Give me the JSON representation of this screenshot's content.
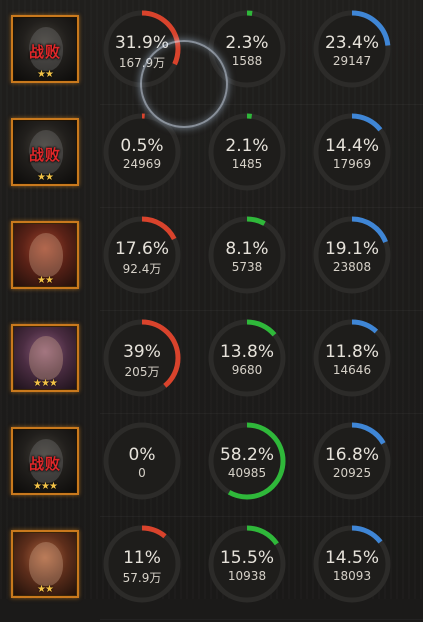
{
  "defeat_label": "战败",
  "colors": {
    "damage": "#d9432c",
    "heal": "#2fb83a",
    "taken": "#3f86d6",
    "track": "#2c2b29"
  },
  "rows": [
    {
      "defeated": true,
      "stars": "★★",
      "portrait": "grey",
      "damage": {
        "pct": "31.9%",
        "value": "167.9万",
        "fill": 0.319
      },
      "heal": {
        "pct": "2.3%",
        "value": "1588",
        "fill": 0.023
      },
      "taken": {
        "pct": "23.4%",
        "value": "29147",
        "fill": 0.234
      }
    },
    {
      "defeated": true,
      "stars": "★★",
      "portrait": "grey",
      "damage": {
        "pct": "0.5%",
        "value": "24969",
        "fill": 0.005
      },
      "heal": {
        "pct": "2.1%",
        "value": "1485",
        "fill": 0.021
      },
      "taken": {
        "pct": "14.4%",
        "value": "17969",
        "fill": 0.144
      }
    },
    {
      "defeated": false,
      "stars": "★★",
      "portrait": "red",
      "damage": {
        "pct": "17.6%",
        "value": "92.4万",
        "fill": 0.176
      },
      "heal": {
        "pct": "8.1%",
        "value": "5738",
        "fill": 0.081
      },
      "taken": {
        "pct": "19.1%",
        "value": "23808",
        "fill": 0.191
      }
    },
    {
      "defeated": false,
      "stars": "★★★",
      "portrait": "purple",
      "damage": {
        "pct": "39%",
        "value": "205万",
        "fill": 0.39
      },
      "heal": {
        "pct": "13.8%",
        "value": "9680",
        "fill": 0.138
      },
      "taken": {
        "pct": "11.8%",
        "value": "14646",
        "fill": 0.118
      }
    },
    {
      "defeated": true,
      "stars": "★★★",
      "portrait": "grey",
      "damage": {
        "pct": "0%",
        "value": "0",
        "fill": 0
      },
      "heal": {
        "pct": "58.2%",
        "value": "40985",
        "fill": 0.582
      },
      "taken": {
        "pct": "16.8%",
        "value": "20925",
        "fill": 0.168
      }
    },
    {
      "defeated": false,
      "stars": "★★",
      "portrait": "warm",
      "damage": {
        "pct": "11%",
        "value": "57.9万",
        "fill": 0.11
      },
      "heal": {
        "pct": "15.5%",
        "value": "10938",
        "fill": 0.155
      },
      "taken": {
        "pct": "14.5%",
        "value": "18093",
        "fill": 0.145
      }
    }
  ]
}
